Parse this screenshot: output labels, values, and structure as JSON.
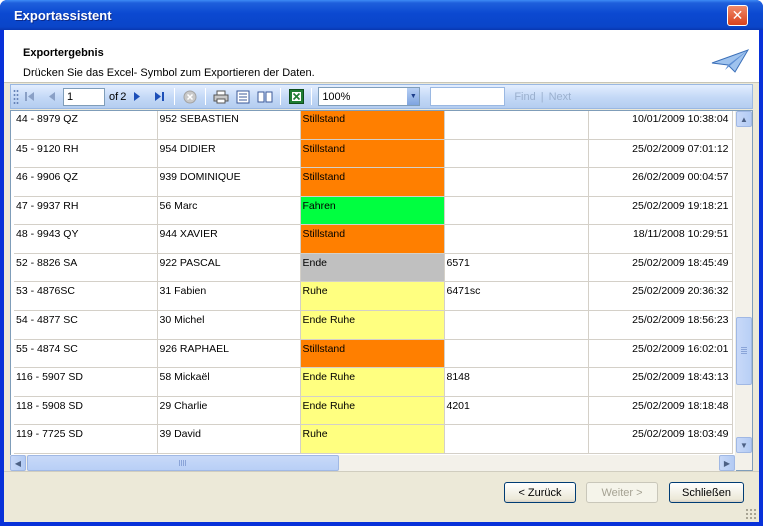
{
  "window": {
    "title": "Exportassistent"
  },
  "header": {
    "title": "Exportergebnis",
    "subtitle": "Drücken Sie das Excel-  Symbol zum Exportieren der Daten."
  },
  "toolbar": {
    "page_current": "1",
    "page_of": "of",
    "page_total": "2",
    "zoom": "100%",
    "find": "Find",
    "find_sep": "|",
    "next": "Next"
  },
  "colors": {
    "Stillstand": "#ff7f00",
    "Fahren": "#00ff40",
    "Ende": "#c0c0c0",
    "Ruhe": "#ffff80",
    "Ende Ruhe": "#ffff80"
  },
  "rows": [
    {
      "vehicle": "44 - 8979 QZ",
      "driver": "952 SEBASTIEN",
      "status": "Stillstand",
      "code": "",
      "datetime": "10/01/2009 10:38:04"
    },
    {
      "vehicle": "45 - 9120 RH",
      "driver": "954 DIDIER",
      "status": "Stillstand",
      "code": "",
      "datetime": "25/02/2009 07:01:12"
    },
    {
      "vehicle": "46 - 9906 QZ",
      "driver": "939 DOMINIQUE",
      "status": "Stillstand",
      "code": "",
      "datetime": "26/02/2009 00:04:57"
    },
    {
      "vehicle": "47 - 9937 RH",
      "driver": "56 Marc",
      "status": "Fahren",
      "code": "",
      "datetime": "25/02/2009 19:18:21"
    },
    {
      "vehicle": "48 - 9943 QY",
      "driver": "944 XAVIER",
      "status": "Stillstand",
      "code": "",
      "datetime": "18/11/2008 10:29:51"
    },
    {
      "vehicle": "52 - 8826 SA",
      "driver": "922 PASCAL",
      "status": "Ende",
      "code": "6571",
      "datetime": "25/02/2009 18:45:49"
    },
    {
      "vehicle": "53 - 4876SC",
      "driver": "31 Fabien",
      "status": "Ruhe",
      "code": "6471sc",
      "datetime": "25/02/2009 20:36:32"
    },
    {
      "vehicle": "54 - 4877 SC",
      "driver": "30 Michel",
      "status": "Ende Ruhe",
      "code": "",
      "datetime": "25/02/2009 18:56:23"
    },
    {
      "vehicle": "55 - 4874 SC",
      "driver": "926 RAPHAEL",
      "status": "Stillstand",
      "code": "",
      "datetime": "25/02/2009 16:02:01"
    },
    {
      "vehicle": "116 - 5907 SD",
      "driver": "58 Mickaël",
      "status": "Ende Ruhe",
      "code": "8148",
      "datetime": "25/02/2009 18:43:13"
    },
    {
      "vehicle": "118 - 5908 SD",
      "driver": "29 Charlie",
      "status": "Ende Ruhe",
      "code": "4201",
      "datetime": "25/02/2009 18:18:48"
    },
    {
      "vehicle": "119 - 7725 SD",
      "driver": "39 David",
      "status": "Ruhe",
      "code": "",
      "datetime": "25/02/2009 18:03:49"
    }
  ],
  "buttons": {
    "back": "< Zurück",
    "next": "Weiter >",
    "close": "Schließen"
  }
}
